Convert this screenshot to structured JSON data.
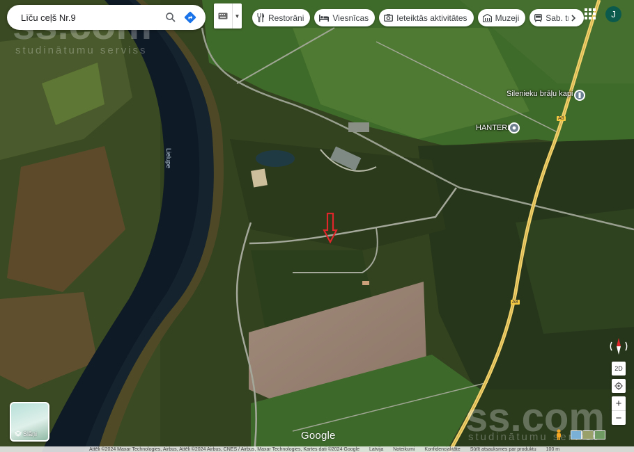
{
  "search": {
    "value": "Līču ceļš Nr.9"
  },
  "chips": [
    {
      "label": "Restorāni",
      "icon": "fork-knife-icon"
    },
    {
      "label": "Viesnīcas",
      "icon": "bed-icon"
    },
    {
      "label": "Ieteiktās aktivitātes",
      "icon": "camera-icon"
    },
    {
      "label": "Muzeji",
      "icon": "museum-icon"
    },
    {
      "label": "Sab. tr",
      "icon": "transit-icon"
    }
  ],
  "account": {
    "initial": "J"
  },
  "map": {
    "places": [
      {
        "name": "Silenieku brāļu kapi",
        "icon": "memorial-pin-icon"
      },
      {
        "name": "HANTERI",
        "icon": "place-pin-icon"
      }
    ],
    "river_name": "Lielupe",
    "road_shields": [
      "A8",
      "A8"
    ],
    "marker": "red-arrow-marker"
  },
  "layers": {
    "label": "Slāņi"
  },
  "controls": {
    "tilt": "2D",
    "zoom_in": "+",
    "zoom_out": "−"
  },
  "watermark": {
    "brand": "ss.com",
    "subtitle": "studinātumu serviss"
  },
  "logo": "Google",
  "footer": {
    "attribution": "Attēli ©2024 Maxar Technologies, Airbus, Attēli ©2024 Airbus, CNES / Airbus, Maxar Technologies, Kartes dati ©2024 Google",
    "country": "Latvija",
    "terms": "Noteikumi",
    "privacy": "Konfidencialitāte",
    "feedback": "Sūtīt atsauksmes par produktu",
    "scale": "100 m"
  },
  "colors": {
    "marker": "#e0262a",
    "road": "#f2d36b",
    "avatar": "#0b5a4c",
    "direction": "#1a73e8"
  }
}
